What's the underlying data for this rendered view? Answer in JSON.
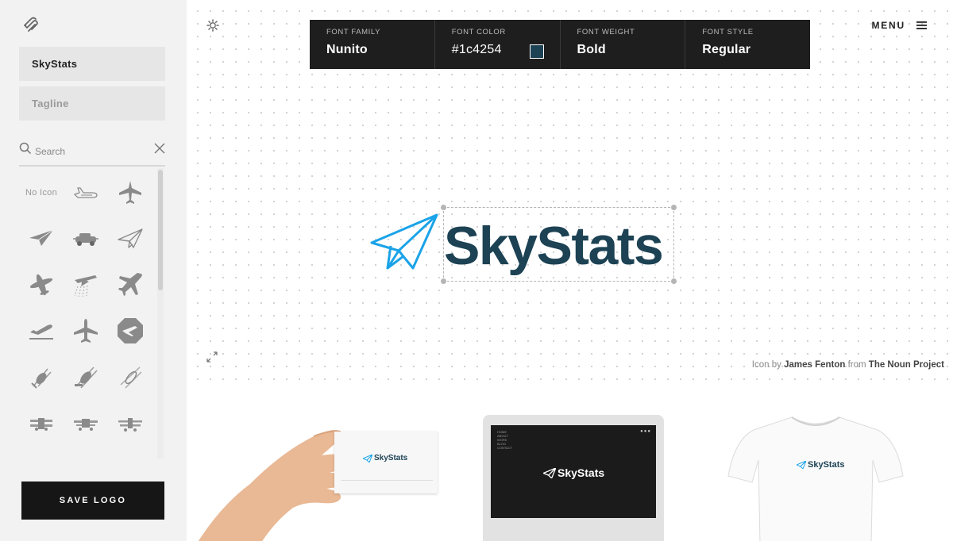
{
  "sidebar": {
    "name_value": "SkyStats",
    "tagline_placeholder": "Tagline",
    "search_placeholder": "Search",
    "no_icon_label": "No Icon",
    "icons": [
      "no-icon",
      "plane-side-outline",
      "airplane",
      "paper-plane-solid",
      "car-plane",
      "paper-plane-outline",
      "propeller-plane",
      "crop-duster",
      "jet",
      "departure",
      "airplane-top",
      "octagon-plane",
      "helicopter",
      "helicopter-2",
      "helicopter-3",
      "biplane",
      "biplane-2",
      "biplane-3"
    ],
    "save_label": "SAVE LOGO"
  },
  "toolbar": {
    "family_label": "FONT FAMILY",
    "family_value": "Nunito",
    "color_label": "FONT COLOR",
    "color_value": "#1c4254",
    "weight_label": "FONT WEIGHT",
    "weight_value": "Bold",
    "style_label": "FONT STYLE",
    "style_value": "Regular"
  },
  "header": {
    "menu_label": "MENU"
  },
  "logo": {
    "text": "SkyStats",
    "text_color": "#1c4254",
    "icon_color": "#1aa3e8"
  },
  "credit": {
    "prefix": "Icon by",
    "author": "James Fenton",
    "middle": "from",
    "source": "The Noun Project"
  },
  "mockups": {
    "card_logo": "SkyStats",
    "monitor_logo": "SkyStats",
    "tshirt_logo": "SkyStats",
    "monitor_menu": [
      "HOME",
      "ABOUT",
      "WORK",
      "BLOG",
      "CONTACT"
    ]
  }
}
